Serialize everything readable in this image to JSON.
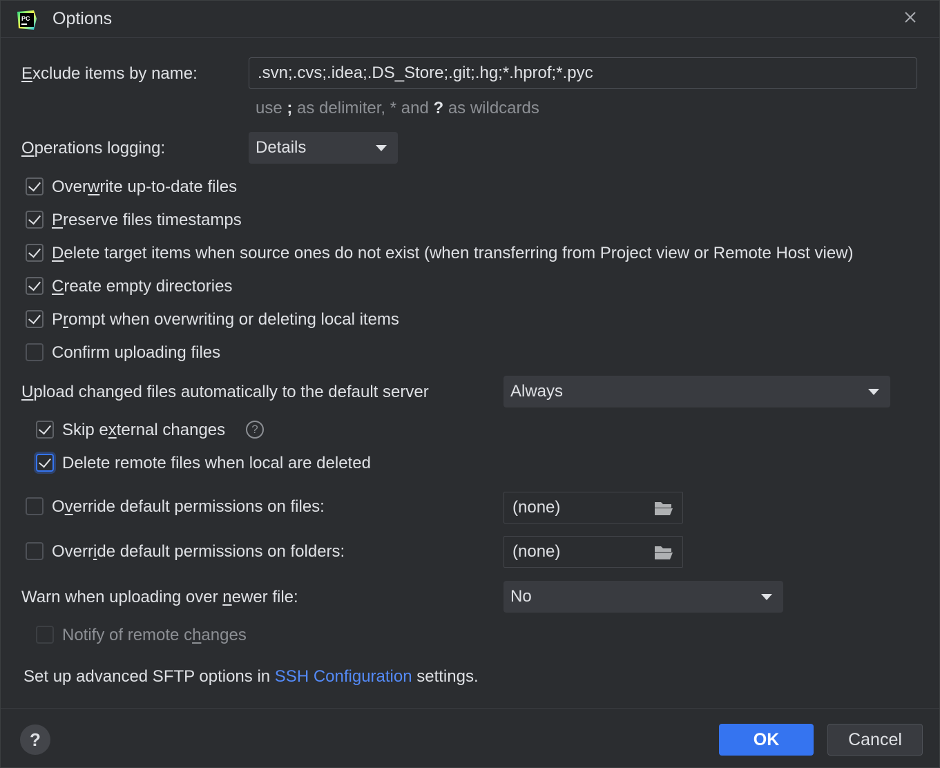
{
  "window": {
    "title": "Options",
    "app_icon": "pycharm-icon"
  },
  "exclude": {
    "label": "Exclude items by name:",
    "value": ".svn;.cvs;.idea;.DS_Store;.git;.hg;*.hprof;*.pyc",
    "hint_prefix": "use ",
    "hint_sep": ";",
    "hint_mid": " as delimiter, * and ",
    "hint_q": "?",
    "hint_suffix": " as wildcards"
  },
  "logging": {
    "label": "Operations logging:",
    "value": "Details"
  },
  "checkboxes": [
    {
      "label": "Overwrite up-to-date files",
      "checked": true
    },
    {
      "label": "Preserve files timestamps",
      "checked": true
    },
    {
      "label": "Delete target items when source ones do not exist (when transferring from Project view or Remote Host view)",
      "checked": true
    },
    {
      "label": "Create empty directories",
      "checked": true
    },
    {
      "label": "Prompt when overwriting or deleting local items",
      "checked": true
    },
    {
      "label": "Confirm uploading files",
      "checked": false
    }
  ],
  "upload": {
    "label": "Upload changed files automatically to the default server",
    "value": "Always",
    "skip_external": {
      "label": "Skip external changes",
      "checked": true
    },
    "delete_remote": {
      "label": "Delete remote files when local are deleted",
      "checked": true
    }
  },
  "perm_files": {
    "label": "Override default permissions on files:",
    "checked": false,
    "value": "(none)"
  },
  "perm_folders": {
    "label": "Override default permissions on folders:",
    "checked": false,
    "value": "(none)"
  },
  "warn": {
    "label": "Warn when uploading over newer file:",
    "value": "No"
  },
  "notify": {
    "label": "Notify of remote changes",
    "checked": false
  },
  "sftp": {
    "prefix": "Set up advanced SFTP options in ",
    "link": "SSH Configuration",
    "suffix": " settings."
  },
  "footer": {
    "help": "?",
    "ok": "OK",
    "cancel": "Cancel"
  },
  "colors": {
    "accent": "#3574f0",
    "link": "#548af7",
    "background": "#2b2d30"
  }
}
